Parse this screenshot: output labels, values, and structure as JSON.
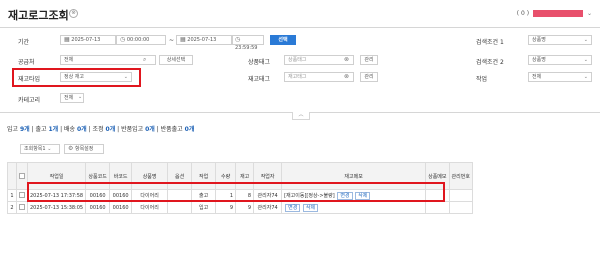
{
  "header": {
    "title": "재고로그조회",
    "title_badge": "⊗",
    "user_prefix": "( 0 )"
  },
  "filters": {
    "period": {
      "label": "기간",
      "date_from": "2025-07-13",
      "time_from": "00:00:00",
      "sep": "~",
      "date_to": "2025-07-13",
      "time_to": "23:59:59",
      "select_label": "선택"
    },
    "supplier": {
      "label": "공급처",
      "value": "전체",
      "detail_btn": "상세선택"
    },
    "stock_type": {
      "label": "재고타입",
      "value": "정상 재고"
    },
    "category": {
      "label": "카테고리",
      "value": "전체"
    },
    "product_tag": {
      "label": "상품태그",
      "placeholder": "상품태그",
      "manage_btn": "관리"
    },
    "stock_tag": {
      "label": "재고태그",
      "placeholder": "재고태그",
      "manage_btn": "관리"
    },
    "search_cond1": {
      "label": "검색조건 1",
      "value": "상품명"
    },
    "search_cond2": {
      "label": "검색조건 2",
      "value": "상품명"
    },
    "worker": {
      "label": "작업",
      "value": "전체"
    }
  },
  "summary": [
    {
      "label": "입고",
      "count": "9개"
    },
    {
      "label": "출고",
      "count": "1개"
    },
    {
      "label": "배송",
      "count": "0개"
    },
    {
      "label": "조정",
      "count": "0개"
    },
    {
      "label": "반품입고",
      "count": "0개"
    },
    {
      "label": "반품출고",
      "count": "0개"
    }
  ],
  "toolbar": {
    "view_select": "조회항목1",
    "settings_btn": "항목설정"
  },
  "table": {
    "headers": [
      "",
      "",
      "작업일",
      "상품코드",
      "바코드",
      "상품명",
      "옵션",
      "작업",
      "수량",
      "재고",
      "작업자",
      "재고메모",
      "상품메모",
      "관리번호"
    ],
    "rows": [
      {
        "no": "1",
        "date": "2025-07-13 17:37:58",
        "code": "00160",
        "barcode": "00160",
        "name": "다이어리",
        "option": "",
        "work": "출고",
        "qty": "1",
        "stock": "8",
        "worker": "관리자74",
        "memo": "[재고이동][정상->불량]",
        "btn1": "변경",
        "btn2": "삭제",
        "pmemo": "",
        "mgmt": ""
      },
      {
        "no": "2",
        "date": "2025-07-13 15:38:05",
        "code": "00160",
        "barcode": "00160",
        "name": "다이어리",
        "option": "",
        "work": "입고",
        "qty": "9",
        "stock": "9",
        "worker": "관리자74",
        "memo": "",
        "btn1": "변경",
        "btn2": "삭제",
        "pmemo": "",
        "mgmt": ""
      }
    ]
  },
  "colors": {
    "accent": "#2a7ad6",
    "highlight": "#e0161e",
    "redaction": "#e8506c"
  }
}
